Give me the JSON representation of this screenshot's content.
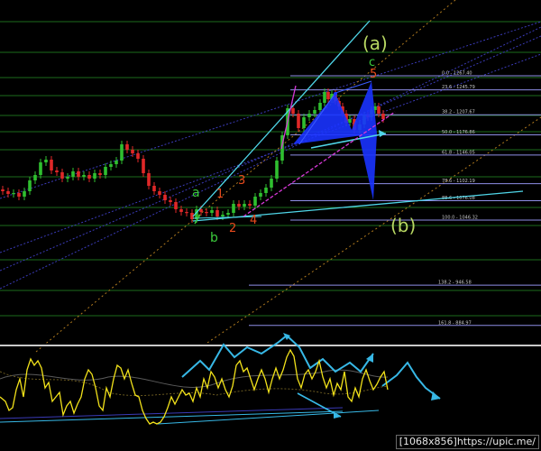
{
  "colors": {
    "background": "#000000",
    "grid_green": "#1d6b1d",
    "fib_line": "#8e8ee6",
    "candle_bull": "#2fbf2f",
    "candle_bear": "#e02828",
    "channel_blue": "#3a3ab6",
    "channel_orange": "#b07a1e",
    "trend_cyan": "#4fd6e8",
    "trend_magenta": "#d638d6",
    "pattern_blue": "#1a33ff",
    "wave_green": "#3ccc3c",
    "wave_red": "#e84a1c",
    "label_yellowgreen": "#b8d862",
    "osc_yellow": "#f2e21a",
    "osc_separator": "#c9c9c9",
    "osc_arrow": "#37b8e6"
  },
  "chart_data": {
    "type": "line",
    "title": "",
    "xlabel": "",
    "ylabel": "",
    "fibonacci_levels": [
      {
        "ratio": "0.0",
        "price": "1267.40",
        "label": "0.0 - 1267.40"
      },
      {
        "ratio": "23.6",
        "price": "1245.79",
        "label": "23.6 - 1245.79"
      },
      {
        "ratio": "38.2",
        "price": "1207.67",
        "label": "38.2 - 1207.67"
      },
      {
        "ratio": "50.0",
        "price": "1176.86",
        "label": "50.0 - 1176.86"
      },
      {
        "ratio": "61.8",
        "price": "1146.05",
        "label": "61.8 - 1146.05"
      },
      {
        "ratio": "78.6",
        "price": "1102.19",
        "label": "78.6 - 1102.19"
      },
      {
        "ratio": "88.6",
        "price": "1076.08",
        "label": "88.6 - 1076.08"
      },
      {
        "ratio": "100.0",
        "price": "1046.32",
        "label": "100.0 - 1046.32"
      },
      {
        "ratio": "138.2",
        "price": "946.58",
        "label": "138.2 - 946.58"
      },
      {
        "ratio": "161.8",
        "price": "884.97",
        "label": "161.8 - 884.97"
      }
    ],
    "price_series": {
      "name": "",
      "points": [
        [
          0,
          210
        ],
        [
          6,
          212
        ],
        [
          12,
          215
        ],
        [
          18,
          214
        ],
        [
          24,
          218
        ],
        [
          30,
          212
        ],
        [
          36,
          200
        ],
        [
          42,
          194
        ],
        [
          48,
          180
        ],
        [
          54,
          177
        ],
        [
          60,
          189
        ],
        [
          66,
          191
        ],
        [
          72,
          198
        ],
        [
          78,
          196
        ],
        [
          84,
          190
        ],
        [
          90,
          196
        ],
        [
          96,
          194
        ],
        [
          102,
          198
        ],
        [
          108,
          192
        ],
        [
          114,
          194
        ],
        [
          120,
          185
        ],
        [
          126,
          182
        ],
        [
          132,
          178
        ],
        [
          138,
          160
        ],
        [
          144,
          166
        ],
        [
          150,
          170
        ],
        [
          156,
          176
        ],
        [
          162,
          192
        ],
        [
          168,
          206
        ],
        [
          174,
          212
        ],
        [
          180,
          216
        ],
        [
          186,
          222
        ],
        [
          192,
          224
        ],
        [
          198,
          232
        ],
        [
          204,
          235
        ],
        [
          210,
          236
        ],
        [
          216,
          243
        ],
        [
          220,
          232
        ],
        [
          226,
          235
        ],
        [
          232,
          236
        ],
        [
          238,
          233
        ],
        [
          244,
          240
        ],
        [
          250,
          238
        ],
        [
          256,
          236
        ],
        [
          262,
          226
        ],
        [
          268,
          229
        ],
        [
          274,
          226
        ],
        [
          280,
          228
        ],
        [
          286,
          218
        ],
        [
          292,
          214
        ],
        [
          298,
          208
        ],
        [
          304,
          198
        ],
        [
          310,
          178
        ],
        [
          316,
          150
        ],
        [
          322,
          120
        ],
        [
          328,
          126
        ],
        [
          334,
          142
        ],
        [
          340,
          130
        ],
        [
          346,
          126
        ],
        [
          352,
          122
        ],
        [
          358,
          114
        ],
        [
          362,
          102
        ],
        [
          366,
          110
        ],
        [
          370,
          104
        ],
        [
          374,
          112
        ],
        [
          378,
          118
        ],
        [
          382,
          126
        ],
        [
          386,
          136
        ],
        [
          390,
          132
        ],
        [
          396,
          144
        ],
        [
          402,
          138
        ],
        [
          406,
          128
        ],
        [
          410,
          130
        ],
        [
          414,
          122
        ],
        [
          418,
          118
        ],
        [
          422,
          126
        ],
        [
          428,
          132
        ]
      ]
    },
    "oscillator_series": {
      "name": "",
      "points": [
        [
          0,
          440
        ],
        [
          6,
          445
        ],
        [
          10,
          455
        ],
        [
          14,
          452
        ],
        [
          18,
          432
        ],
        [
          22,
          420
        ],
        [
          26,
          440
        ],
        [
          30,
          410
        ],
        [
          34,
          398
        ],
        [
          38,
          405
        ],
        [
          42,
          400
        ],
        [
          46,
          408
        ],
        [
          50,
          430
        ],
        [
          54,
          424
        ],
        [
          58,
          445
        ],
        [
          62,
          440
        ],
        [
          66,
          435
        ],
        [
          70,
          460
        ],
        [
          74,
          450
        ],
        [
          78,
          445
        ],
        [
          82,
          458
        ],
        [
          86,
          448
        ],
        [
          90,
          440
        ],
        [
          94,
          420
        ],
        [
          98,
          410
        ],
        [
          102,
          415
        ],
        [
          106,
          430
        ],
        [
          110,
          450
        ],
        [
          114,
          455
        ],
        [
          118,
          430
        ],
        [
          122,
          440
        ],
        [
          126,
          420
        ],
        [
          130,
          405
        ],
        [
          134,
          408
        ],
        [
          138,
          420
        ],
        [
          142,
          410
        ],
        [
          146,
          425
        ],
        [
          150,
          438
        ],
        [
          154,
          440
        ],
        [
          158,
          455
        ],
        [
          162,
          464
        ],
        [
          166,
          470
        ],
        [
          170,
          468
        ],
        [
          174,
          470
        ],
        [
          178,
          468
        ],
        [
          182,
          462
        ],
        [
          186,
          452
        ],
        [
          190,
          440
        ],
        [
          194,
          448
        ],
        [
          198,
          440
        ],
        [
          202,
          432
        ],
        [
          206,
          438
        ],
        [
          210,
          436
        ],
        [
          214,
          445
        ],
        [
          218,
          430
        ],
        [
          222,
          440
        ],
        [
          226,
          420
        ],
        [
          230,
          430
        ],
        [
          234,
          412
        ],
        [
          238,
          418
        ],
        [
          242,
          430
        ],
        [
          246,
          420
        ],
        [
          250,
          432
        ],
        [
          254,
          440
        ],
        [
          258,
          428
        ],
        [
          262,
          405
        ],
        [
          266,
          400
        ],
        [
          270,
          412
        ],
        [
          274,
          408
        ],
        [
          278,
          420
        ],
        [
          282,
          432
        ],
        [
          286,
          420
        ],
        [
          290,
          410
        ],
        [
          294,
          420
        ],
        [
          298,
          435
        ],
        [
          302,
          420
        ],
        [
          306,
          408
        ],
        [
          310,
          420
        ],
        [
          314,
          410
        ],
        [
          318,
          396
        ],
        [
          322,
          388
        ],
        [
          326,
          395
        ],
        [
          330,
          420
        ],
        [
          334,
          430
        ],
        [
          338,
          415
        ],
        [
          342,
          410
        ],
        [
          346,
          420
        ],
        [
          350,
          412
        ],
        [
          354,
          400
        ],
        [
          358,
          418
        ],
        [
          362,
          430
        ],
        [
          366,
          420
        ],
        [
          370,
          438
        ],
        [
          374,
          425
        ],
        [
          378,
          432
        ],
        [
          382,
          412
        ],
        [
          386,
          440
        ],
        [
          390,
          445
        ],
        [
          394,
          430
        ],
        [
          398,
          440
        ],
        [
          402,
          420
        ],
        [
          406,
          410
        ],
        [
          410,
          422
        ],
        [
          414,
          432
        ],
        [
          418,
          426
        ],
        [
          422,
          418
        ],
        [
          426,
          412
        ],
        [
          430,
          432
        ]
      ]
    },
    "wave_labels": [
      {
        "text": "(a)",
        "color": "label_yellowgreen"
      },
      {
        "text": "c",
        "color": "wave_green"
      },
      {
        "text": "5",
        "color": "wave_red"
      },
      {
        "text": "a",
        "color": "wave_green"
      },
      {
        "text": "1",
        "color": "wave_red"
      },
      {
        "text": "3",
        "color": "wave_red"
      },
      {
        "text": "b",
        "color": "wave_green"
      },
      {
        "text": "2",
        "color": "wave_red"
      },
      {
        "text": "4",
        "color": "wave_red"
      },
      {
        "text": "(b)",
        "color": "label_yellowgreen"
      }
    ]
  },
  "watermark": "[1068x856]https://upic.me/"
}
